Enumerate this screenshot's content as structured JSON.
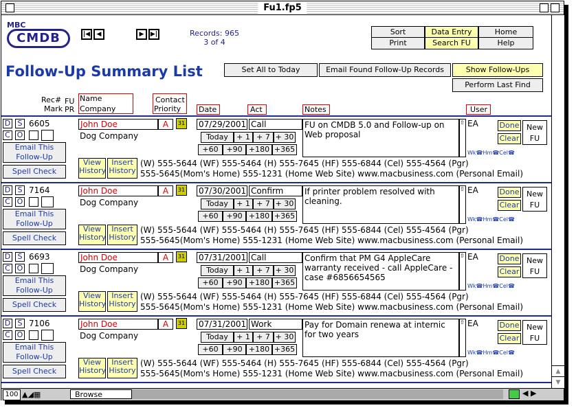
{
  "window": {
    "title": "Fu1.fp5"
  },
  "logo": {
    "line1": "MBC",
    "line2": "CMDB"
  },
  "nav": {
    "first": "◀",
    "prev": "◀",
    "next": "▶",
    "last": "▶"
  },
  "records": {
    "label": "Records: 965",
    "position": "3 of 4"
  },
  "topbuttons": {
    "sort": "Sort",
    "data_entry": "Data Entry",
    "home": "Home",
    "print": "Print",
    "search_fu": "Search FU",
    "help": "Help"
  },
  "page": {
    "title": "Follow-Up Summary List"
  },
  "actions": {
    "set_all": "Set All to Today",
    "email_found": "Email Found Follow-Up Records",
    "show_followups": "Show Follow-Ups",
    "perform_last_find": "Perform Last Find"
  },
  "columns": {
    "rec": "Rec#",
    "mark": "Mark",
    "fu": "FU",
    "pr": "PR",
    "name": "Name",
    "company": "Company",
    "contact": "Contact",
    "priority": "Priority",
    "date": "Date",
    "act": "Act",
    "notes": "Notes",
    "user": "User"
  },
  "labels": {
    "d": "D",
    "s": "S",
    "c": "C",
    "o": "O",
    "email_this": "Email This",
    "follow_up": "Follow-Up",
    "spell_check": "Spell Check",
    "view": "View",
    "history": "History",
    "insert": "Insert",
    "today": "Today",
    "p1": "+ 1",
    "p7": "+ 7",
    "p30": "+ 30",
    "p60": "+60",
    "p90": "+90",
    "p180": "+180",
    "p365": "+365",
    "done": "Done",
    "clear": "Clear",
    "new": "New",
    "fu": "FU",
    "pri_a": "A"
  },
  "records_list": [
    {
      "id": "6605",
      "name": "John Doe",
      "company": "Dog Company",
      "priority": "A",
      "date": "07/29/2001",
      "act": "Call",
      "notes": "FU on CMDB 5.0 and Follow-up on Web proposal",
      "user": "EA",
      "phones": "(W) 555-5644 (WF) 555-5464 (H) 555-7645 (HF) 555-6844 (Cel) 555-4564 (Pgr)",
      "web": "555-5645(Mom's Home) 555-1231 (Home Web Site) www.macbusiness.com (Personal Email)"
    },
    {
      "id": "7164",
      "name": "John Doe",
      "company": "Dog Company",
      "priority": "A",
      "date": "07/30/2001",
      "act": "Confirm",
      "notes": "If printer problem resolved with cleaning.",
      "user": "EA",
      "phones": "(W) 555-5644 (WF) 555-5464 (H) 555-7645 (HF) 555-6844 (Cel) 555-4564 (Pgr)",
      "web": "555-5645(Mom's Home) 555-1231 (Home Web Site) www.macbusiness.com (Personal Email)"
    },
    {
      "id": "6693",
      "name": "John Doe",
      "company": "Dog Company",
      "priority": "A",
      "date": "07/31/2001",
      "act": "Call",
      "notes": "Confirm that PM G4 AppleCare warranty received - call AppleCare - case #6856654565",
      "user": "EA",
      "phones": "(W) 555-5644 (WF) 555-5464 (H) 555-7645 (HF) 555-6844 (Cel) 555-4564 (Pgr)",
      "web": "555-5645(Mom's Home) 555-1231 (Home Web Site) www.macbusiness.com (Personal Email)"
    },
    {
      "id": "7106",
      "name": "John Doe",
      "company": "Dog Company",
      "priority": "A",
      "date": "07/31/2001",
      "act": "Work",
      "notes": "Pay for Domain renewa at internic for two years",
      "user": "EA",
      "phones": "(W) 555-5644 (WF) 555-5464 (H) 555-7645 (HF) 555-6844 (Cel) 555-4564 (Pgr)",
      "web": "555-5645(Mom's Home) 555-1231 (Home Web Site) www.macbusiness.com (Personal Email)"
    }
  ],
  "status": {
    "zoom": "100",
    "mode": "Browse"
  },
  "colors": {
    "accent": "#1a3aa8",
    "name_red": "#dd0000",
    "yellow": "#ffffb0"
  }
}
